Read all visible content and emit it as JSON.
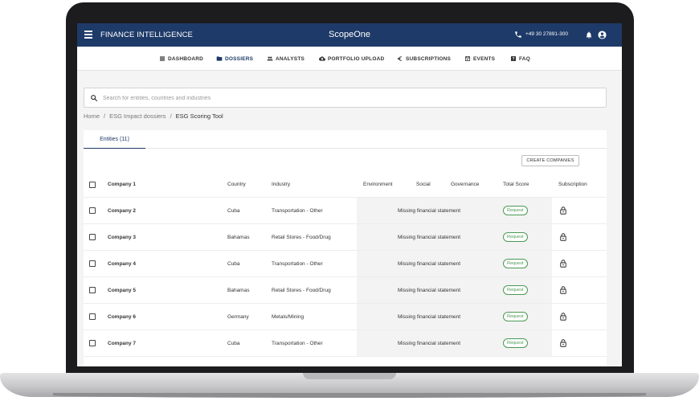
{
  "app": {
    "brand": "FINANCE INTELLIGENCE",
    "title": "ScopeOne",
    "phone": "+49 30 27891-300",
    "accent_color": "#1e3a68",
    "icons": {
      "menu": "menu-icon",
      "phone": "phone-icon",
      "notifications": "bell-icon",
      "account": "account-icon"
    }
  },
  "nav": {
    "items": [
      {
        "label": "DASHBOARD",
        "icon": "dashboard-icon"
      },
      {
        "label": "DOSSIERS",
        "icon": "folder-icon",
        "active": true
      },
      {
        "label": "ANALYSTS",
        "icon": "people-icon"
      },
      {
        "label": "PORTFOLIO UPLOAD",
        "icon": "cloud-upload-icon"
      },
      {
        "label": "SUBSCRIPTIONS",
        "icon": "euro-icon"
      },
      {
        "label": "EVENTS",
        "icon": "calendar-icon"
      },
      {
        "label": "FAQ",
        "icon": "help-icon"
      }
    ]
  },
  "search": {
    "placeholder": "Search for entities, countries and industries",
    "value": ""
  },
  "breadcrumb": {
    "items": [
      "Home",
      "ESG Impact dossiers",
      "ESG Scoring Tool"
    ],
    "separator": "/"
  },
  "tabs": [
    {
      "label": "Entities (11)",
      "active": true
    }
  ],
  "toolbar": {
    "create_label": "CREATE COMPANIES"
  },
  "table": {
    "columns": {
      "company": "Company 1",
      "country": "Country",
      "industry": "Industry",
      "environment": "Environment",
      "social": "Social",
      "governance": "Governance",
      "total": "Total Score",
      "subscription": "Subscription"
    },
    "rows": [
      {
        "company": "Company 2",
        "country": "Cuba",
        "industry": "Transportation - Other",
        "status": "Missing financial statement",
        "action": "Request"
      },
      {
        "company": "Company 3",
        "country": "Bahamas",
        "industry": "Retail Stores - Food/Drug",
        "status": "Missing financial statement",
        "action": "Request"
      },
      {
        "company": "Company 4",
        "country": "Cuba",
        "industry": "Transportation - Other",
        "status": "Missing financial statement",
        "action": "Request"
      },
      {
        "company": "Company 5",
        "country": "Bahamas",
        "industry": "Retail Stores - Food/Drug",
        "status": "Missing financial statement",
        "action": "Request"
      },
      {
        "company": "Company 6",
        "country": "Germany",
        "industry": "Metals/Mining",
        "status": "Missing financial statement",
        "action": "Request"
      },
      {
        "company": "Company 7",
        "country": "Cuba",
        "industry": "Transportation - Other",
        "status": "Missing financial statement",
        "action": "Request"
      }
    ],
    "subscription_icon": "lock-icon",
    "badge_color": "#4a9a52"
  }
}
